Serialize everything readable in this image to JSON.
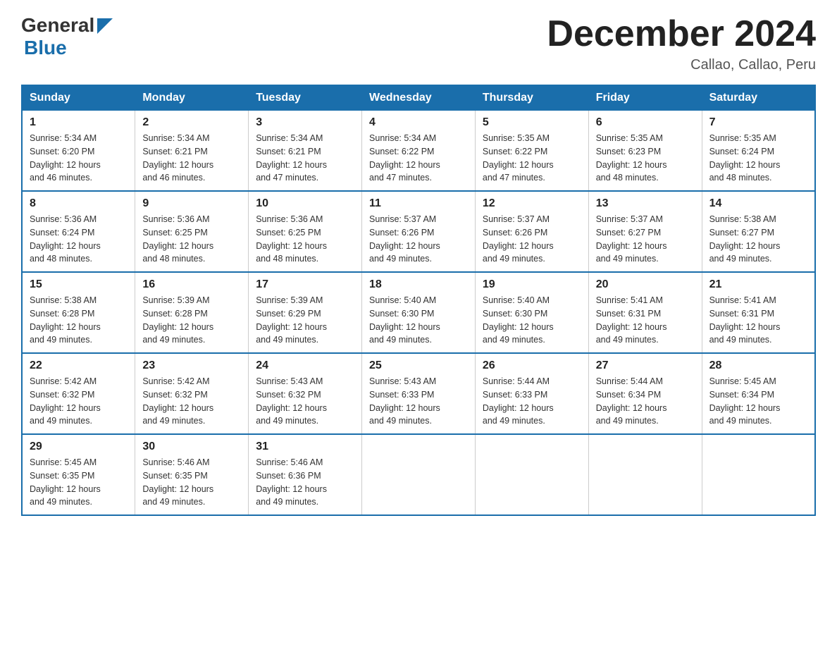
{
  "header": {
    "logo_general": "General",
    "logo_blue": "Blue",
    "month_title": "December 2024",
    "location": "Callao, Callao, Peru"
  },
  "days_of_week": [
    "Sunday",
    "Monday",
    "Tuesday",
    "Wednesday",
    "Thursday",
    "Friday",
    "Saturday"
  ],
  "weeks": [
    [
      {
        "day": "1",
        "sunrise": "5:34 AM",
        "sunset": "6:20 PM",
        "daylight": "12 hours and 46 minutes."
      },
      {
        "day": "2",
        "sunrise": "5:34 AM",
        "sunset": "6:21 PM",
        "daylight": "12 hours and 46 minutes."
      },
      {
        "day": "3",
        "sunrise": "5:34 AM",
        "sunset": "6:21 PM",
        "daylight": "12 hours and 47 minutes."
      },
      {
        "day": "4",
        "sunrise": "5:34 AM",
        "sunset": "6:22 PM",
        "daylight": "12 hours and 47 minutes."
      },
      {
        "day": "5",
        "sunrise": "5:35 AM",
        "sunset": "6:22 PM",
        "daylight": "12 hours and 47 minutes."
      },
      {
        "day": "6",
        "sunrise": "5:35 AM",
        "sunset": "6:23 PM",
        "daylight": "12 hours and 48 minutes."
      },
      {
        "day": "7",
        "sunrise": "5:35 AM",
        "sunset": "6:24 PM",
        "daylight": "12 hours and 48 minutes."
      }
    ],
    [
      {
        "day": "8",
        "sunrise": "5:36 AM",
        "sunset": "6:24 PM",
        "daylight": "12 hours and 48 minutes."
      },
      {
        "day": "9",
        "sunrise": "5:36 AM",
        "sunset": "6:25 PM",
        "daylight": "12 hours and 48 minutes."
      },
      {
        "day": "10",
        "sunrise": "5:36 AM",
        "sunset": "6:25 PM",
        "daylight": "12 hours and 48 minutes."
      },
      {
        "day": "11",
        "sunrise": "5:37 AM",
        "sunset": "6:26 PM",
        "daylight": "12 hours and 49 minutes."
      },
      {
        "day": "12",
        "sunrise": "5:37 AM",
        "sunset": "6:26 PM",
        "daylight": "12 hours and 49 minutes."
      },
      {
        "day": "13",
        "sunrise": "5:37 AM",
        "sunset": "6:27 PM",
        "daylight": "12 hours and 49 minutes."
      },
      {
        "day": "14",
        "sunrise": "5:38 AM",
        "sunset": "6:27 PM",
        "daylight": "12 hours and 49 minutes."
      }
    ],
    [
      {
        "day": "15",
        "sunrise": "5:38 AM",
        "sunset": "6:28 PM",
        "daylight": "12 hours and 49 minutes."
      },
      {
        "day": "16",
        "sunrise": "5:39 AM",
        "sunset": "6:28 PM",
        "daylight": "12 hours and 49 minutes."
      },
      {
        "day": "17",
        "sunrise": "5:39 AM",
        "sunset": "6:29 PM",
        "daylight": "12 hours and 49 minutes."
      },
      {
        "day": "18",
        "sunrise": "5:40 AM",
        "sunset": "6:30 PM",
        "daylight": "12 hours and 49 minutes."
      },
      {
        "day": "19",
        "sunrise": "5:40 AM",
        "sunset": "6:30 PM",
        "daylight": "12 hours and 49 minutes."
      },
      {
        "day": "20",
        "sunrise": "5:41 AM",
        "sunset": "6:31 PM",
        "daylight": "12 hours and 49 minutes."
      },
      {
        "day": "21",
        "sunrise": "5:41 AM",
        "sunset": "6:31 PM",
        "daylight": "12 hours and 49 minutes."
      }
    ],
    [
      {
        "day": "22",
        "sunrise": "5:42 AM",
        "sunset": "6:32 PM",
        "daylight": "12 hours and 49 minutes."
      },
      {
        "day": "23",
        "sunrise": "5:42 AM",
        "sunset": "6:32 PM",
        "daylight": "12 hours and 49 minutes."
      },
      {
        "day": "24",
        "sunrise": "5:43 AM",
        "sunset": "6:32 PM",
        "daylight": "12 hours and 49 minutes."
      },
      {
        "day": "25",
        "sunrise": "5:43 AM",
        "sunset": "6:33 PM",
        "daylight": "12 hours and 49 minutes."
      },
      {
        "day": "26",
        "sunrise": "5:44 AM",
        "sunset": "6:33 PM",
        "daylight": "12 hours and 49 minutes."
      },
      {
        "day": "27",
        "sunrise": "5:44 AM",
        "sunset": "6:34 PM",
        "daylight": "12 hours and 49 minutes."
      },
      {
        "day": "28",
        "sunrise": "5:45 AM",
        "sunset": "6:34 PM",
        "daylight": "12 hours and 49 minutes."
      }
    ],
    [
      {
        "day": "29",
        "sunrise": "5:45 AM",
        "sunset": "6:35 PM",
        "daylight": "12 hours and 49 minutes."
      },
      {
        "day": "30",
        "sunrise": "5:46 AM",
        "sunset": "6:35 PM",
        "daylight": "12 hours and 49 minutes."
      },
      {
        "day": "31",
        "sunrise": "5:46 AM",
        "sunset": "6:36 PM",
        "daylight": "12 hours and 49 minutes."
      },
      null,
      null,
      null,
      null
    ]
  ],
  "labels": {
    "sunrise": "Sunrise:",
    "sunset": "Sunset:",
    "daylight": "Daylight:"
  }
}
